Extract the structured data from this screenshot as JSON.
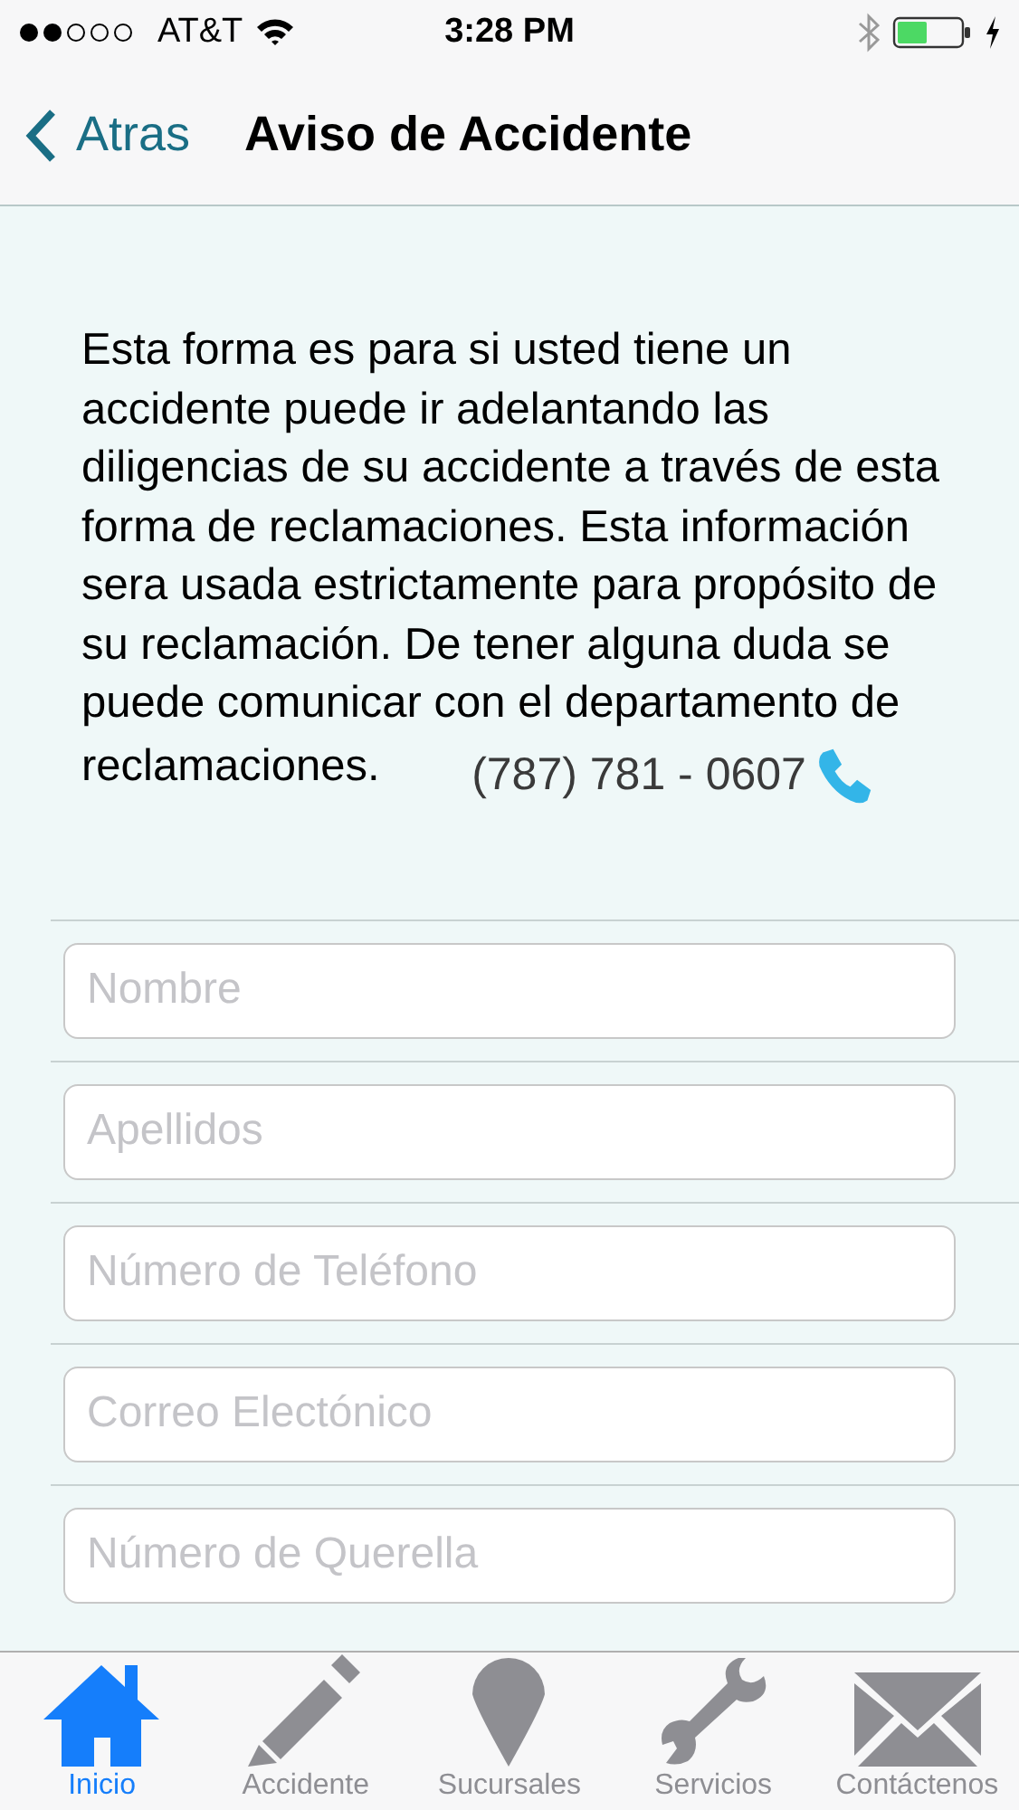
{
  "status_bar": {
    "carrier": "AT&T",
    "time": "3:28 PM"
  },
  "nav_bar": {
    "back": "Atras",
    "title": "Aviso de Accidente"
  },
  "intro": "Esta forma es para si usted tiene un accidente puede ir adelantando las diligencias de su accidente a través de esta forma de reclamaciones. Esta información sera usada estrictamente para propósito de su reclamación. De tener alguna duda se puede comunicar con el departamento de reclamaciones.",
  "phone": "(787) 781 - 0607",
  "fields": [
    {
      "placeholder": "Nombre"
    },
    {
      "placeholder": "Apellidos"
    },
    {
      "placeholder": "Número de Teléfono"
    },
    {
      "placeholder": "Correo Electónico"
    },
    {
      "placeholder": "Número de Querella"
    }
  ],
  "tabs": [
    {
      "label": "Inicio",
      "kind": "home",
      "selected": true
    },
    {
      "label": "Accidente",
      "kind": "pencil",
      "selected": false
    },
    {
      "label": "Sucursales",
      "kind": "pin",
      "selected": false
    },
    {
      "label": "Servicios",
      "kind": "wrench",
      "selected": false
    },
    {
      "label": "Contáctenos",
      "kind": "mail",
      "selected": false
    }
  ]
}
